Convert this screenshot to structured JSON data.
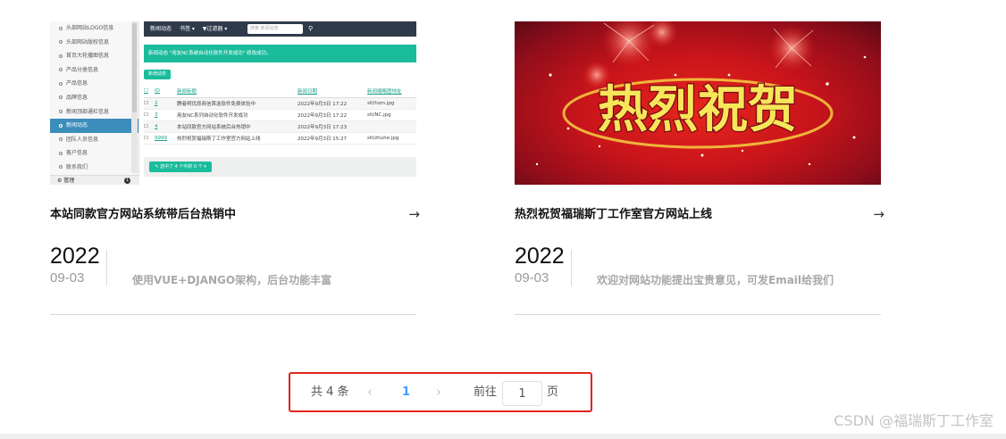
{
  "articles": [
    {
      "title": "本站同款官方网站系统带后台热销中",
      "year": "2022",
      "monthday": "09-03",
      "description": "使用VUE+DJANGO架构，后台功能丰富",
      "arrow_icon": "arrow-right-icon",
      "thumbnail": {
        "sidebar_items": [
          "头部网站LOGO信息",
          "头部网站版权信息",
          "首页大轮播图信息",
          "产品分类信息",
          "产品信息",
          "品牌信息",
          "新闻顶部通栏信息",
          "新闻动态",
          "团队人员信息",
          "客户信息",
          "联系我们"
        ],
        "active_item": "新闻动态",
        "manage_label": "管理",
        "manage_badge": "1",
        "top_title": "新闻动态",
        "top_menu1": "书签 ▾",
        "top_menu2": "▼过滤器 ▾",
        "search_placeholder": "搜索 新闻动态",
        "alert_text": "新闻动态 \"用友NC系统自动化软件开发成功\" 修改成功。",
        "add_button": "新增动态",
        "table_headers": [
          "ID",
          "新闻标题",
          "新闻日期",
          "新闻缩略图地址"
        ],
        "rows": [
          [
            "2",
            "腾者明优原商信首选软件免费体验中",
            "2022年9月3日 17:22",
            "slt/hzm.jpg"
          ],
          [
            "3",
            "用友NC系列自动化软件开发成功",
            "2022年9月3日 17:22",
            "slt/NC.jpg"
          ],
          [
            "4",
            "本站同款官方网站系统后台热销中",
            "2022年9月3日 17:23",
            ""
          ],
          [
            "9999",
            "热烈祝贺福瑞斯丁工作室官方网站上线",
            "2022年9月3日 15:27",
            "slt/zhuhe.jpg"
          ]
        ],
        "footer_button": "✎ 选中了 4 个中的 0 个 ▾"
      }
    },
    {
      "title": "热烈祝贺福瑞斯丁工作室官方网站上线",
      "year": "2022",
      "monthday": "09-03",
      "description": "欢迎对网站功能提出宝贵意见，可发Email给我们",
      "arrow_icon": "arrow-right-icon",
      "thumbnail": {
        "banner_text": "热烈祝贺",
        "colors": {
          "bg": "#c8141b",
          "text": "#f6e65a",
          "outline": "#7a0a12"
        }
      }
    }
  ],
  "pagination": {
    "total_text": "共 4 条",
    "prev_icon": "chevron-left-icon",
    "current_page": "1",
    "next_icon": "chevron-right-icon",
    "goto_label": "前往",
    "goto_value": "1",
    "page_suffix": "页",
    "accent_color": "#409eff",
    "highlight_border_color": "#e0251c"
  },
  "watermark": "CSDN @福瑞斯丁工作室"
}
